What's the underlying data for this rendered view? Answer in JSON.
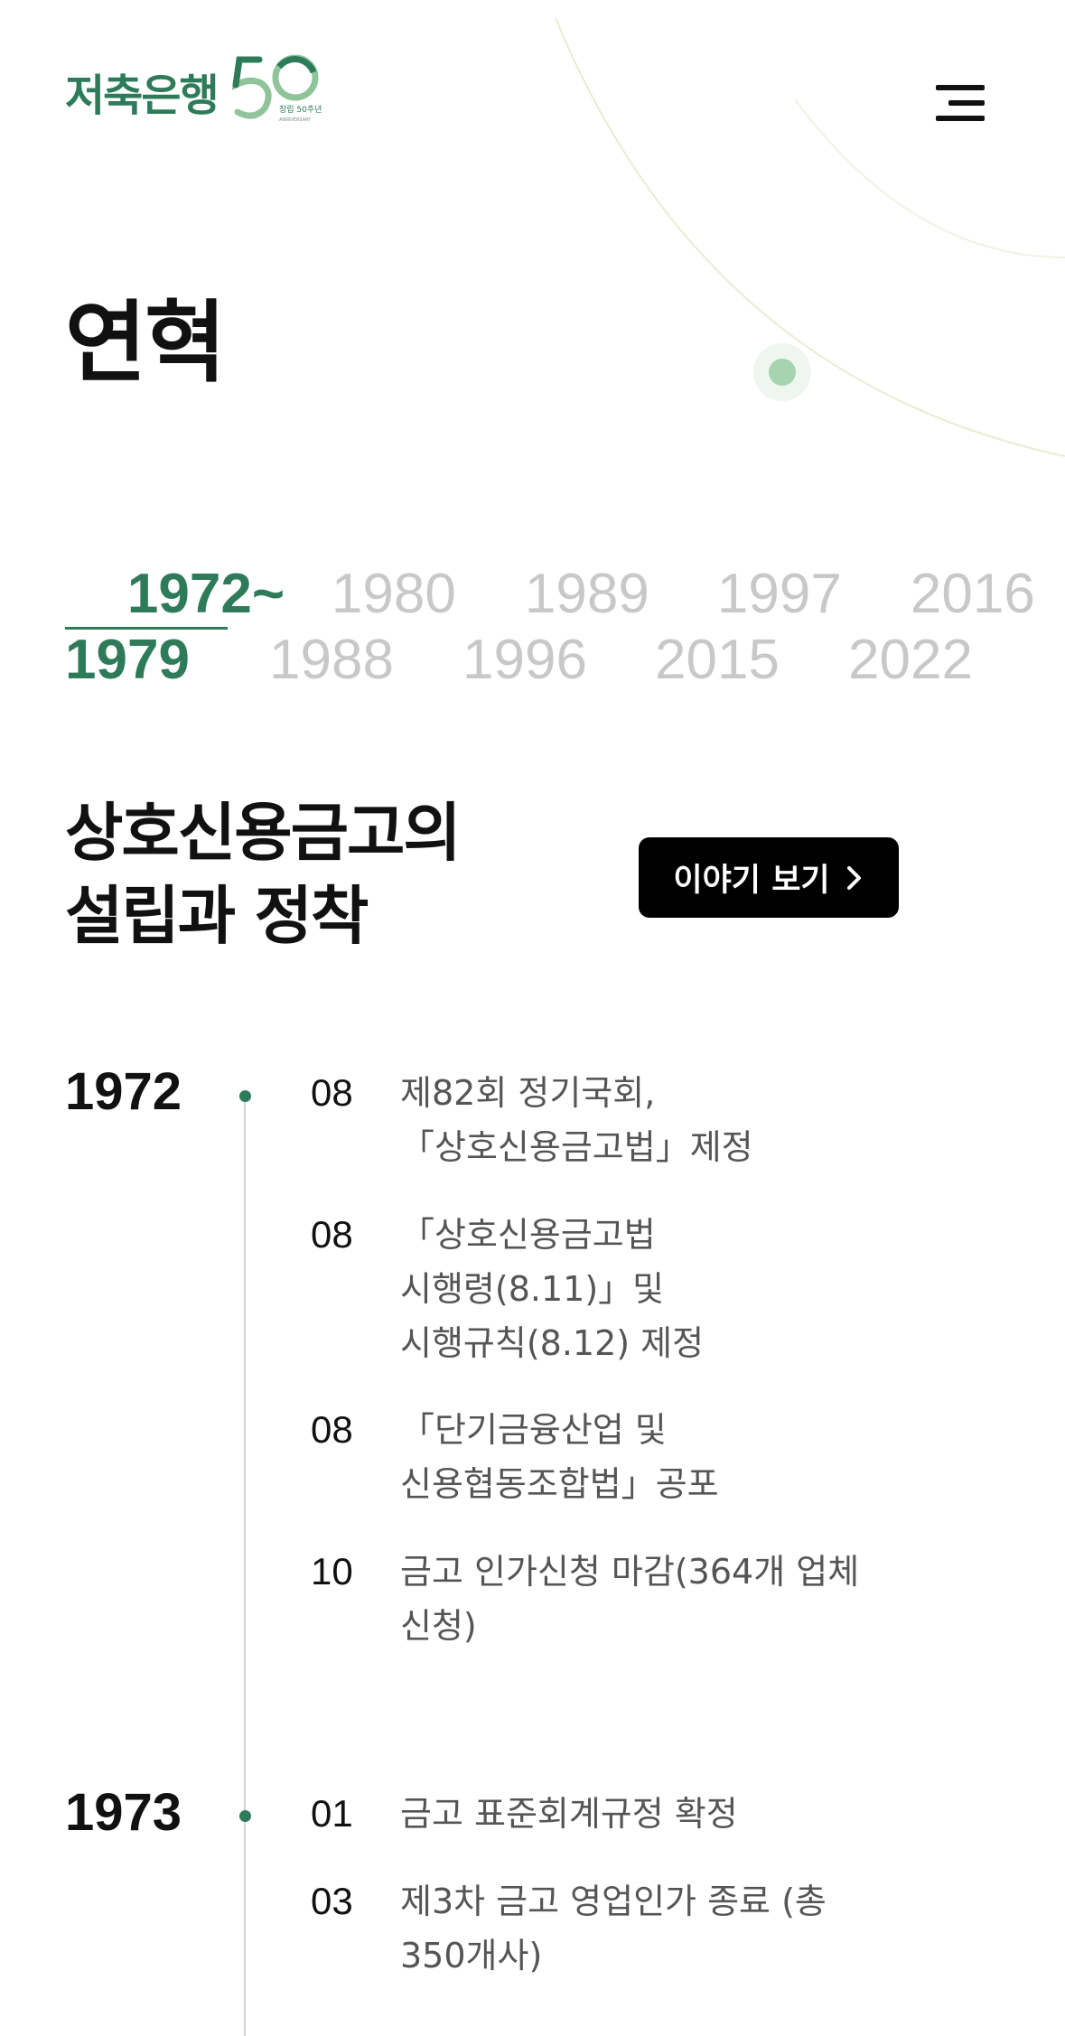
{
  "header": {
    "logo_text": "저축은행",
    "logo_badge": "창립 50주년",
    "logo_badge_sub": "ANNIVERSARY",
    "menu_icon": "hamburger-icon"
  },
  "page": {
    "title": "연혁"
  },
  "period_tabs": [
    {
      "label": "1972~\n1979",
      "active": true
    },
    {
      "label": "1980\n1988",
      "active": false
    },
    {
      "label": "1989\n1996",
      "active": false
    },
    {
      "label": "1997\n2015",
      "active": false
    },
    {
      "label": "2016\n2022",
      "active": false
    }
  ],
  "era": {
    "title": "상호신용금고의\n설립과 정착",
    "story_button": "이야기 보기",
    "story_icon": "chevron-right-icon"
  },
  "timeline": [
    {
      "year": "1972",
      "events": [
        {
          "month": "08",
          "text": "제82회 정기국회,\n「상호신용금고법」제정"
        },
        {
          "month": "08",
          "text": "「상호신용금고법\n시행령(8.11)」및\n시행규칙(8.12) 제정"
        },
        {
          "month": "08",
          "text": "「단기금융산업 및\n신용협동조합법」공포"
        },
        {
          "month": "10",
          "text": "금고 인가신청 마감(364개 업체\n신청)"
        }
      ]
    },
    {
      "year": "1973",
      "events": [
        {
          "month": "01",
          "text": "금고 표준회계규정 확정"
        },
        {
          "month": "03",
          "text": "제3차 금고 영업인가 종료 (총\n350개사)"
        }
      ]
    }
  ],
  "colors": {
    "accent": "#2e7b5a",
    "inactive_tab": "#c8c8c8",
    "button_bg": "#000000"
  }
}
